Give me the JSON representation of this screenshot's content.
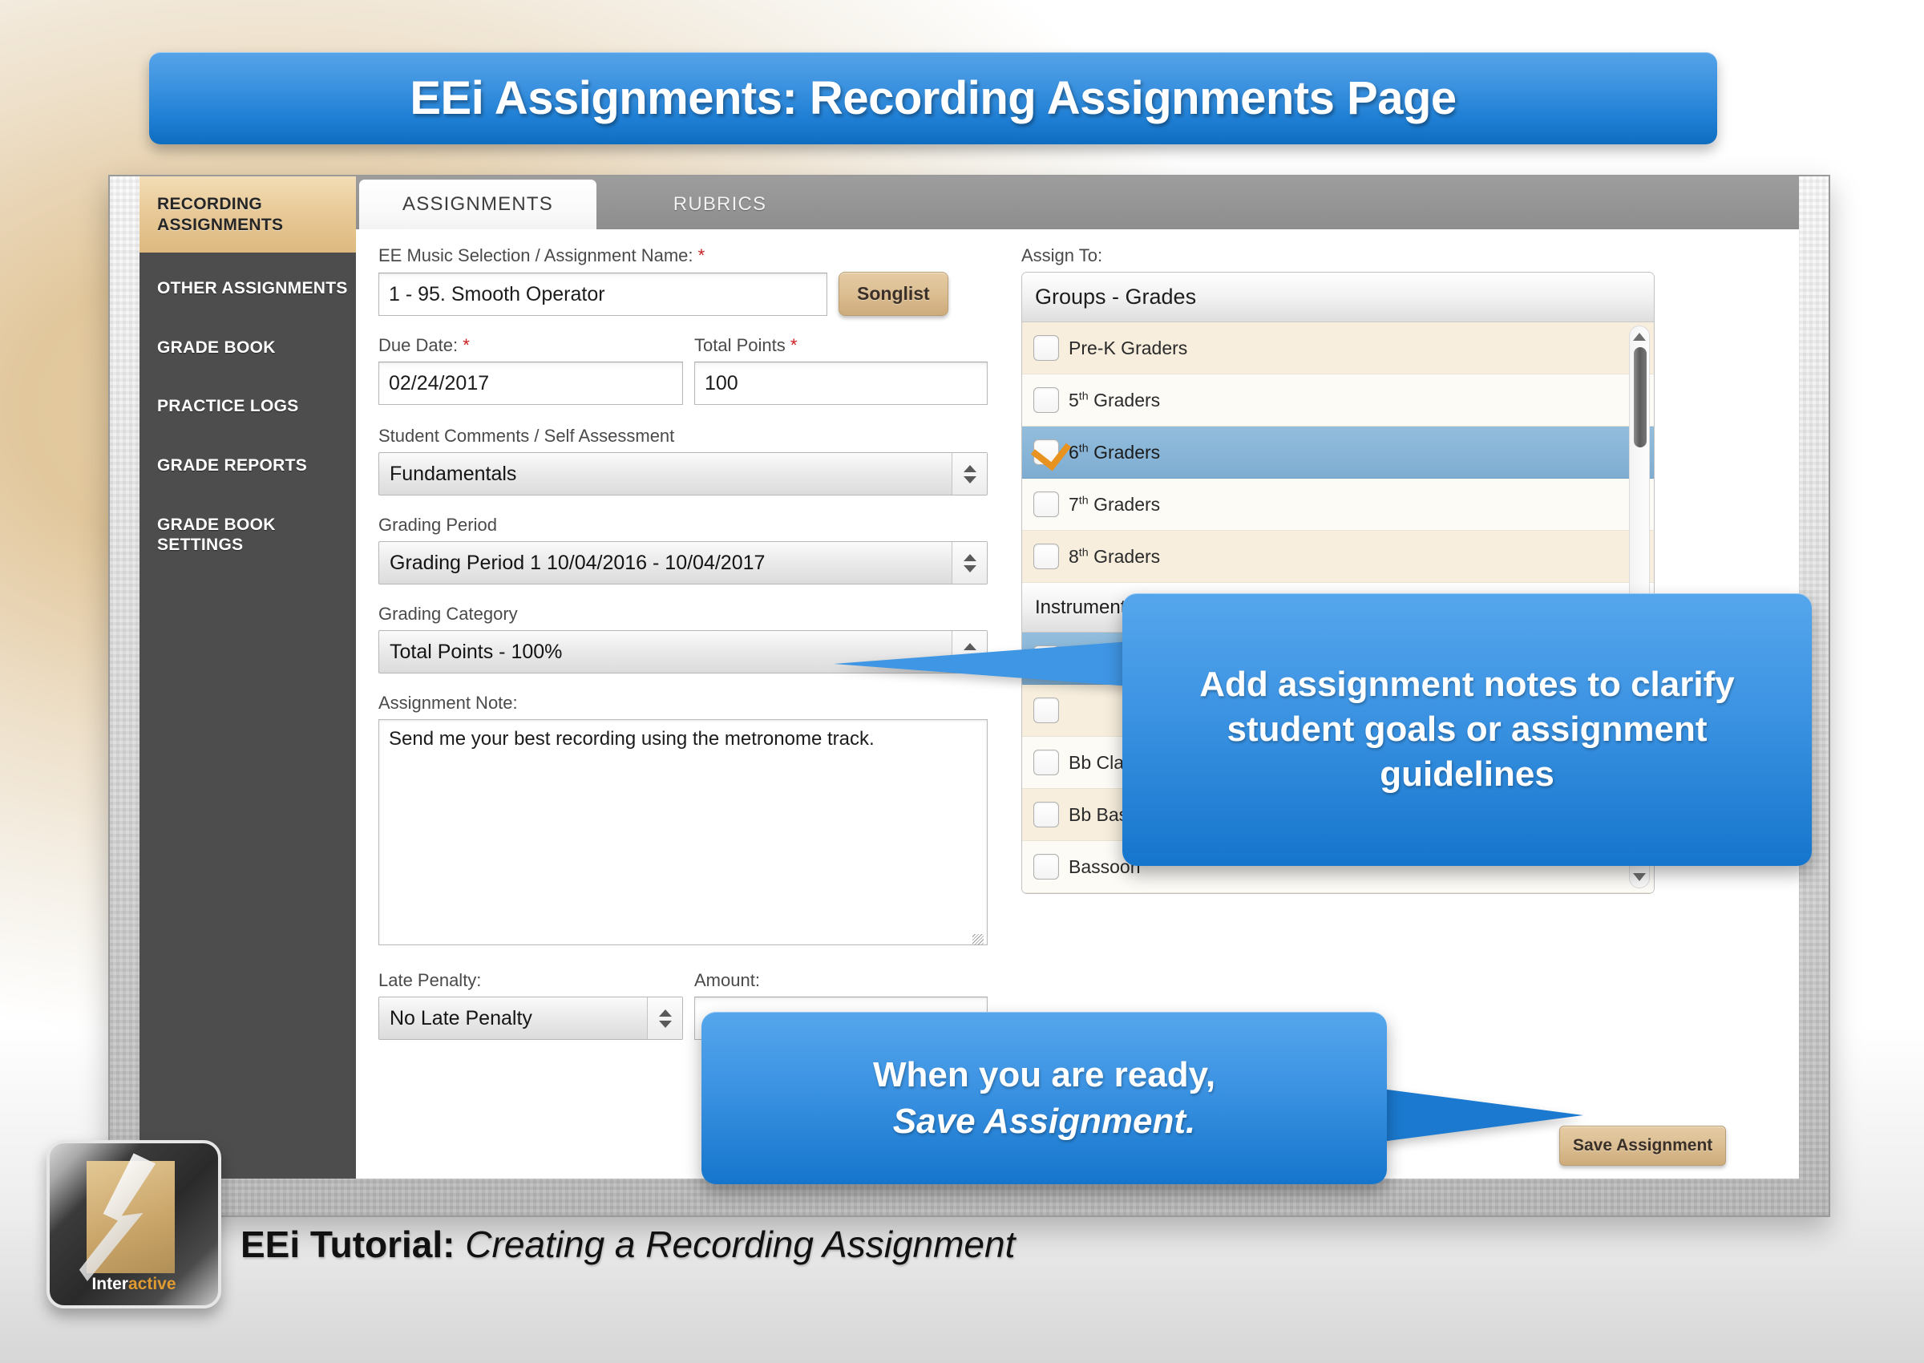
{
  "banner": {
    "title": "EEi Assignments: Recording Assignments Page"
  },
  "sidebar": {
    "items": [
      {
        "label": "RECORDING ASSIGNMENTS",
        "active": true
      },
      {
        "label": "OTHER ASSIGNMENTS",
        "active": false
      },
      {
        "label": "GRADE BOOK",
        "active": false
      },
      {
        "label": "PRACTICE LOGS",
        "active": false
      },
      {
        "label": "GRADE REPORTS",
        "active": false
      },
      {
        "label": "GRADE BOOK SETTINGS",
        "active": false
      }
    ]
  },
  "tabs": [
    {
      "label": "ASSIGNMENTS",
      "active": true
    },
    {
      "label": "RUBRICS",
      "active": false
    }
  ],
  "form": {
    "music_selection": {
      "label": "EE Music Selection / Assignment Name:",
      "required_marker": "*",
      "value": "1 - 95. Smooth Operator"
    },
    "songlist_button": "Songlist",
    "due_date": {
      "label": "Due Date:",
      "required_marker": "*",
      "value": "02/24/2017"
    },
    "total_points": {
      "label": "Total Points",
      "required_marker": "*",
      "value": "100"
    },
    "student_comments": {
      "label": "Student Comments / Self Assessment",
      "value": "Fundamentals"
    },
    "grading_period": {
      "label": "Grading Period",
      "value": "Grading Period 1 10/04/2016 - 10/04/2017"
    },
    "grading_category": {
      "label": "Grading Category",
      "value": "Total Points - 100%"
    },
    "assignment_note": {
      "label": "Assignment Note:",
      "value": "Send me your best recording using the metronome track."
    },
    "late_penalty": {
      "label": "Late Penalty:",
      "value": "No Late Penalty"
    },
    "amount": {
      "label": "Amount:",
      "value": ""
    }
  },
  "assign_to": {
    "label": "Assign To:",
    "groups_header": "Groups - Grades",
    "groups": [
      {
        "label": "Pre-K Graders",
        "checked": false,
        "selected": false,
        "sup": ""
      },
      {
        "label": "Graders",
        "prefix": "5",
        "sup": "th",
        "checked": false,
        "selected": false
      },
      {
        "label": "Graders",
        "prefix": "6",
        "sup": "th",
        "checked": true,
        "selected": true
      },
      {
        "label": "Graders",
        "prefix": "7",
        "sup": "th",
        "checked": false,
        "selected": false
      },
      {
        "label": "Graders",
        "prefix": "8",
        "sup": "th",
        "checked": false,
        "selected": false
      }
    ],
    "instruments_header": "Instruments",
    "instruments": [
      {
        "label": "",
        "checked": true,
        "selected": true
      },
      {
        "label": "",
        "checked": false,
        "selected": false
      },
      {
        "label": "Bb Clarinet",
        "checked": false,
        "selected": false
      },
      {
        "label": "Bb Bass Clarinet",
        "checked": false,
        "selected": false
      },
      {
        "label": "Bassoon",
        "checked": false,
        "selected": false
      }
    ]
  },
  "save_button": {
    "label": "Save Assignment"
  },
  "callouts": {
    "note_callout": "Add assignment notes to clarify student goals or assignment guidelines",
    "save_callout_line1": "When you are ready,",
    "save_callout_line2": "Save Assignment."
  },
  "footer": {
    "logo_word_prefix": "Inter",
    "logo_word_suffix": "active",
    "caption_bold": "EEi Tutorial:",
    "caption_italic": "Creating a Recording Assignment"
  },
  "colors": {
    "accent_blue": "#3d94e3",
    "tan": "#dcbf93",
    "sidebar": "#4d4d4d",
    "check_orange": "#e8921f",
    "required_red": "#cc1d1d"
  }
}
